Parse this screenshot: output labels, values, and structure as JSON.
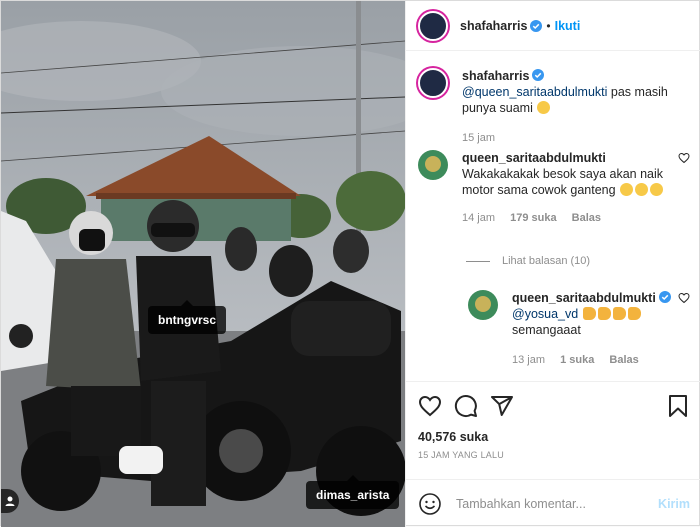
{
  "post": {
    "author": "shafaharris",
    "follow_label": "Ikuti",
    "caption_mention": "@queen_saritaabdulmukti",
    "caption_text": "pas masih punya suami",
    "caption_time": "15 jam",
    "photo_tags": [
      "bntngvrsc",
      "dimas_arista"
    ]
  },
  "comments": [
    {
      "user": "queen_saritaabdulmukti",
      "text": "Wakakakakak besok saya akan naik motor sama cowok ganteng",
      "time": "14 jam",
      "likes": "179 suka",
      "reply_label": "Balas",
      "view_replies": "Lihat balasan (10)"
    }
  ],
  "replies": [
    {
      "user": "queen_saritaabdulmukti",
      "mention": "@yosua_vd",
      "text": "semangaaat",
      "time": "13 jam",
      "likes": "1 suka",
      "reply_label": "Balas"
    }
  ],
  "actions": {
    "likes_count": "40,576 suka",
    "date_label": "15 JAM YANG LALU"
  },
  "composer": {
    "placeholder": "Tambahkan komentar...",
    "post_label": "Kirim"
  },
  "icons": [
    "heart-icon",
    "comment-icon",
    "share-icon",
    "bookmark-icon",
    "emoji-icon",
    "verified-icon",
    "person-tag-icon"
  ],
  "colors": {
    "accent": "#0095f6",
    "verified": "#3897f0",
    "muted": "#8e8e8e",
    "post_disabled": "#b2dffc"
  }
}
